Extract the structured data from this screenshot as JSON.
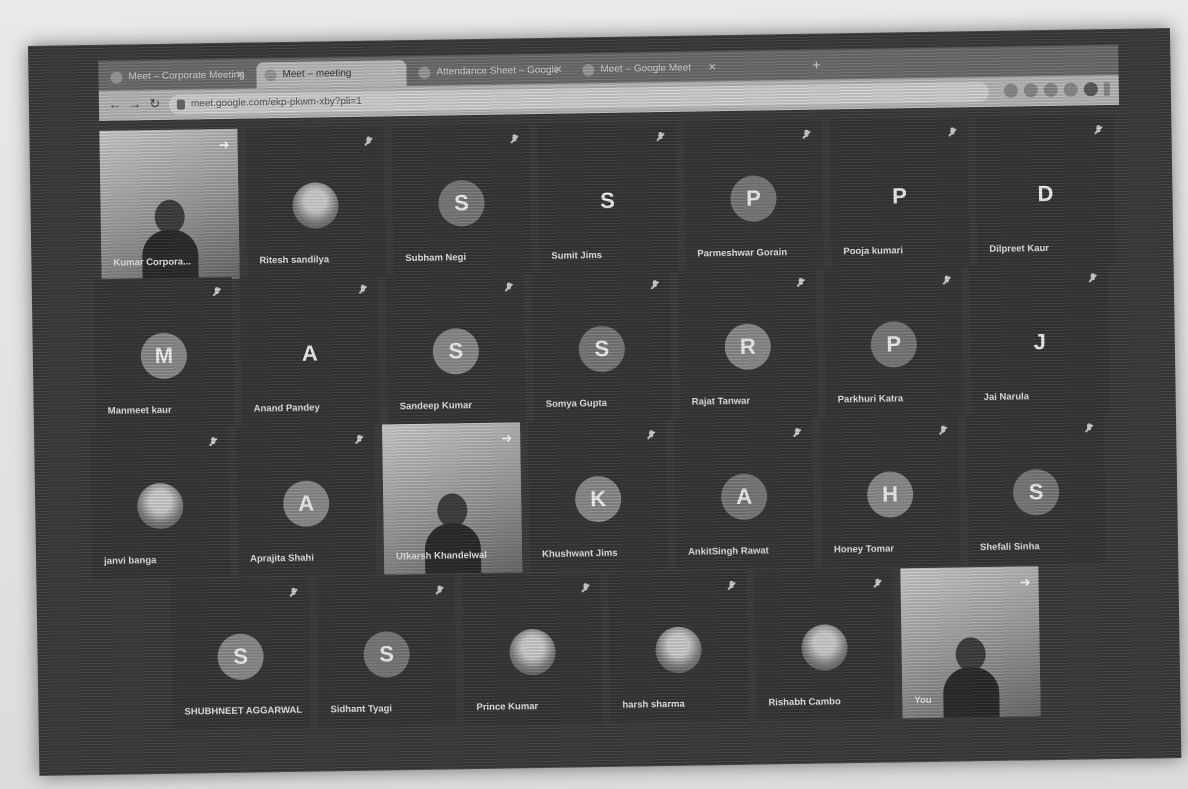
{
  "browser": {
    "tabs": [
      {
        "label": "Meet – Corporate Meeting"
      },
      {
        "label": "Meet – meeting"
      },
      {
        "label": "Attendance Sheet – Google"
      },
      {
        "label": "Meet – Google Meet"
      }
    ],
    "new_tab_label": "+",
    "url": "meet.google.com/ekp-pkwm-xby?pli=1"
  },
  "meet": {
    "rows": [
      [
        {
          "name": "Kumar Corpora...",
          "initial": "",
          "type": "video"
        },
        {
          "name": "Ritesh sandilya",
          "initial": "",
          "type": "photo"
        },
        {
          "name": "Subham Negi",
          "initial": "S",
          "type": "letter"
        },
        {
          "name": "Sumit Jims",
          "initial": "S",
          "type": "bare"
        },
        {
          "name": "Parmeshwar Gorain",
          "initial": "P",
          "type": "letter"
        },
        {
          "name": "Pooja kumari",
          "initial": "P",
          "type": "bare"
        },
        {
          "name": "Dilpreet Kaur",
          "initial": "D",
          "type": "bare"
        }
      ],
      [
        {
          "name": "Manmeet kaur",
          "initial": "M",
          "type": "letter"
        },
        {
          "name": "Anand Pandey",
          "initial": "A",
          "type": "bare"
        },
        {
          "name": "Sandeep Kumar",
          "initial": "S",
          "type": "letter"
        },
        {
          "name": "Somya Gupta",
          "initial": "S",
          "type": "letter"
        },
        {
          "name": "Rajat Tanwar",
          "initial": "R",
          "type": "letter"
        },
        {
          "name": "Parkhuri Katra",
          "initial": "P",
          "type": "letter"
        },
        {
          "name": "Jai Narula",
          "initial": "J",
          "type": "bare"
        }
      ],
      [
        {
          "name": "janvi banga",
          "initial": "",
          "type": "photo"
        },
        {
          "name": "Aprajita Shahi",
          "initial": "A",
          "type": "letter"
        },
        {
          "name": "Utkarsh Khandelwal",
          "initial": "",
          "type": "video"
        },
        {
          "name": "Khushwant Jims",
          "initial": "K",
          "type": "letter"
        },
        {
          "name": "AnkitSingh Rawat",
          "initial": "A",
          "type": "letter"
        },
        {
          "name": "Honey Tomar",
          "initial": "H",
          "type": "letter"
        },
        {
          "name": "Shefali Sinha",
          "initial": "S",
          "type": "letter"
        }
      ],
      [
        {
          "name": "SHUBHNEET AGGARWAL",
          "initial": "S",
          "type": "letter"
        },
        {
          "name": "Sidhant Tyagi",
          "initial": "S",
          "type": "letter"
        },
        {
          "name": "Prince Kumar",
          "initial": "",
          "type": "photo"
        },
        {
          "name": "harsh sharma",
          "initial": "",
          "type": "photo"
        },
        {
          "name": "Rishabh Cambo",
          "initial": "",
          "type": "photo"
        },
        {
          "name": "You",
          "initial": "",
          "type": "video"
        }
      ]
    ],
    "colors": {
      "tile_bg": "#353535",
      "avatar_gray": "#7a7a7a",
      "avatar_light": "#8c8c8c"
    }
  }
}
